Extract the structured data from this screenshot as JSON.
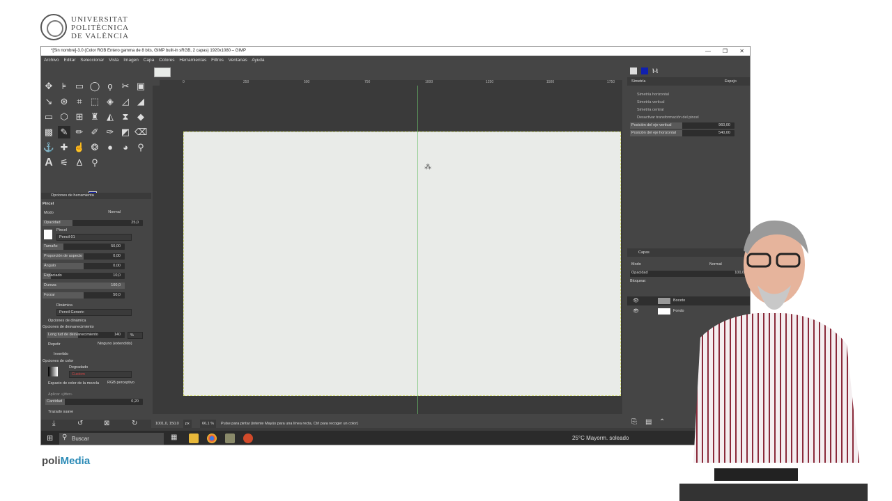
{
  "university": {
    "line1": "UNIVERSITAT",
    "line2": "POLITÈCNICA",
    "line3": "DE VALÈNCIA"
  },
  "brand": {
    "poli": "poli",
    "media": "Media"
  },
  "window": {
    "title": "*[Sin nombre]-3.0 (Color RGB Entero gamma de 8 bits, GIMP built-in sRGB, 2 capas) 1920x1080 – GIMP"
  },
  "menu": [
    "Archivo",
    "Editar",
    "Seleccionar",
    "Vista",
    "Imagen",
    "Capa",
    "Colores",
    "Herramientas",
    "Filtros",
    "Ventanas",
    "Ayuda"
  ],
  "ruler": {
    "ticks": [
      "0",
      "250",
      "500",
      "750",
      "1000",
      "1250",
      "1500",
      "1750"
    ]
  },
  "tool_options": {
    "tab": "Opciones de herramienta",
    "tool_name": "Pincel",
    "mode_label": "Modo",
    "mode_value": "Normal",
    "opacity_label": "Opacidad",
    "opacity_value": "25,0",
    "brush_label": "Pincel",
    "brush_value": "Pencil 01",
    "size_label": "Tamaño",
    "size_value": "50,00",
    "aspect_label": "Proporción de aspecto",
    "aspect_value": "0,00",
    "angle_label": "Ángulo",
    "angle_value": "0,00",
    "spacing_label": "Espaciado",
    "spacing_value": "10,0",
    "hardness_label": "Dureza",
    "hardness_value": "100,0",
    "force_label": "Forzar",
    "force_value": "50,0",
    "dynamics_label": "Dinámica",
    "dynamics_value": "Pencil Generic",
    "dynamics_options": "Opciones de dinámica",
    "fade_options": "Opciones de desvanecimiento",
    "fade_length_label": "Long tud de desvanecimiento",
    "fade_length_value": "140",
    "fade_unit": "%",
    "repeat_label": "Repetir",
    "repeat_value": "Ninguno (extendido)",
    "inverted": "Invertido",
    "color_options": "Opciones de color",
    "gradient_label": "Degradado",
    "gradient_value": "Custom",
    "blend_space_label": "Espacio de color de la mezcla",
    "blend_space_value": "RGB perceptivo",
    "jitter": "Aplicar «jitter»",
    "amount_label": "Cantidad",
    "amount_value": "0,20",
    "smooth": "Trazado suave"
  },
  "status": {
    "coords": "1001,0, 150,0",
    "unit": "px",
    "zoom": "66,1 %",
    "message": "Pulse para pintar (intente Mayús para una línea recta, Ctrl para recoger un color)"
  },
  "symmetry": {
    "title": "Simetría",
    "mode": "Espejo",
    "opt_h": "Simetría horizontal",
    "opt_v": "Simetría vertical",
    "opt_c": "Simetría central",
    "opt_t": "Desactivar transformación del pincel",
    "axis_v_label": "Posición del eje vertical",
    "axis_v_value": "960,00",
    "axis_h_label": "Posición del eje horizontal",
    "axis_h_value": "540,00"
  },
  "layers": {
    "tab": "Capas",
    "mode_label": "Modo",
    "mode_value": "Normal",
    "opacity_label": "Opacidad",
    "opacity_value": "100,0",
    "lock_label": "Bloquear:",
    "items": [
      {
        "name": "Boceto"
      },
      {
        "name": "Fondo"
      }
    ]
  },
  "taskbar": {
    "search": "Buscar",
    "weather": "25°C  Mayorm. soleado"
  },
  "colors": {
    "fg": "#1020b0",
    "bg": "#ffffff",
    "accent": "#2a8ab6"
  }
}
